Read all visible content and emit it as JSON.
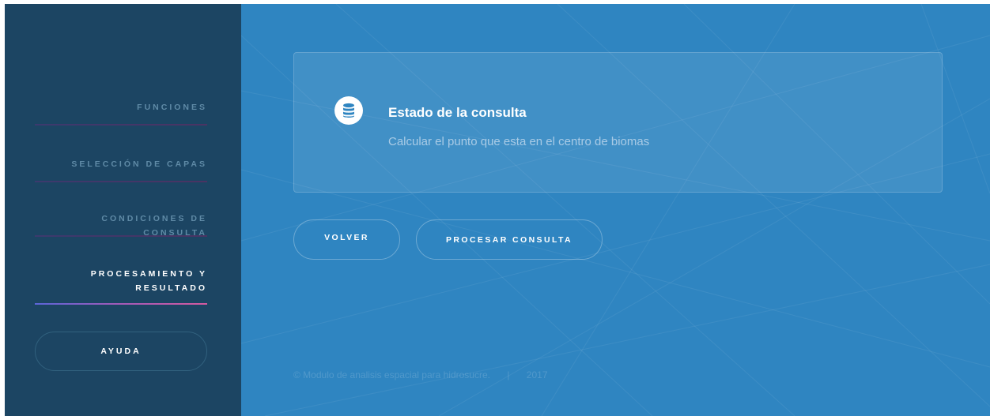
{
  "sidebar": {
    "nav_items": [
      {
        "label": "FUNCIONES",
        "active": false
      },
      {
        "label": "SELECCIÓN DE CAPAS",
        "active": false
      },
      {
        "label": "CONDICIONES DE CONSULTA",
        "active": false
      },
      {
        "label_line1": "PROCESAMIENTO Y",
        "label_line2": "RESULTADO",
        "active": true
      }
    ],
    "help_label": "AYUDA"
  },
  "status_card": {
    "icon": "database-icon",
    "title": "Estado de la consulta",
    "message": "Calcular el punto que esta en el centro de biomas"
  },
  "actions": {
    "back_label": "VOLVER",
    "process_label": "PROCESAR CONSULTA"
  },
  "footer": {
    "copyright": "© Modulo de analisis espacial para hidrosucre.",
    "separator": "|",
    "year": "2017"
  },
  "colors": {
    "sidebar_bg": "#1c4563",
    "main_bg": "#2f85c1",
    "active_underline_start": "#5b66d8",
    "active_underline_end": "#d45aa0"
  }
}
